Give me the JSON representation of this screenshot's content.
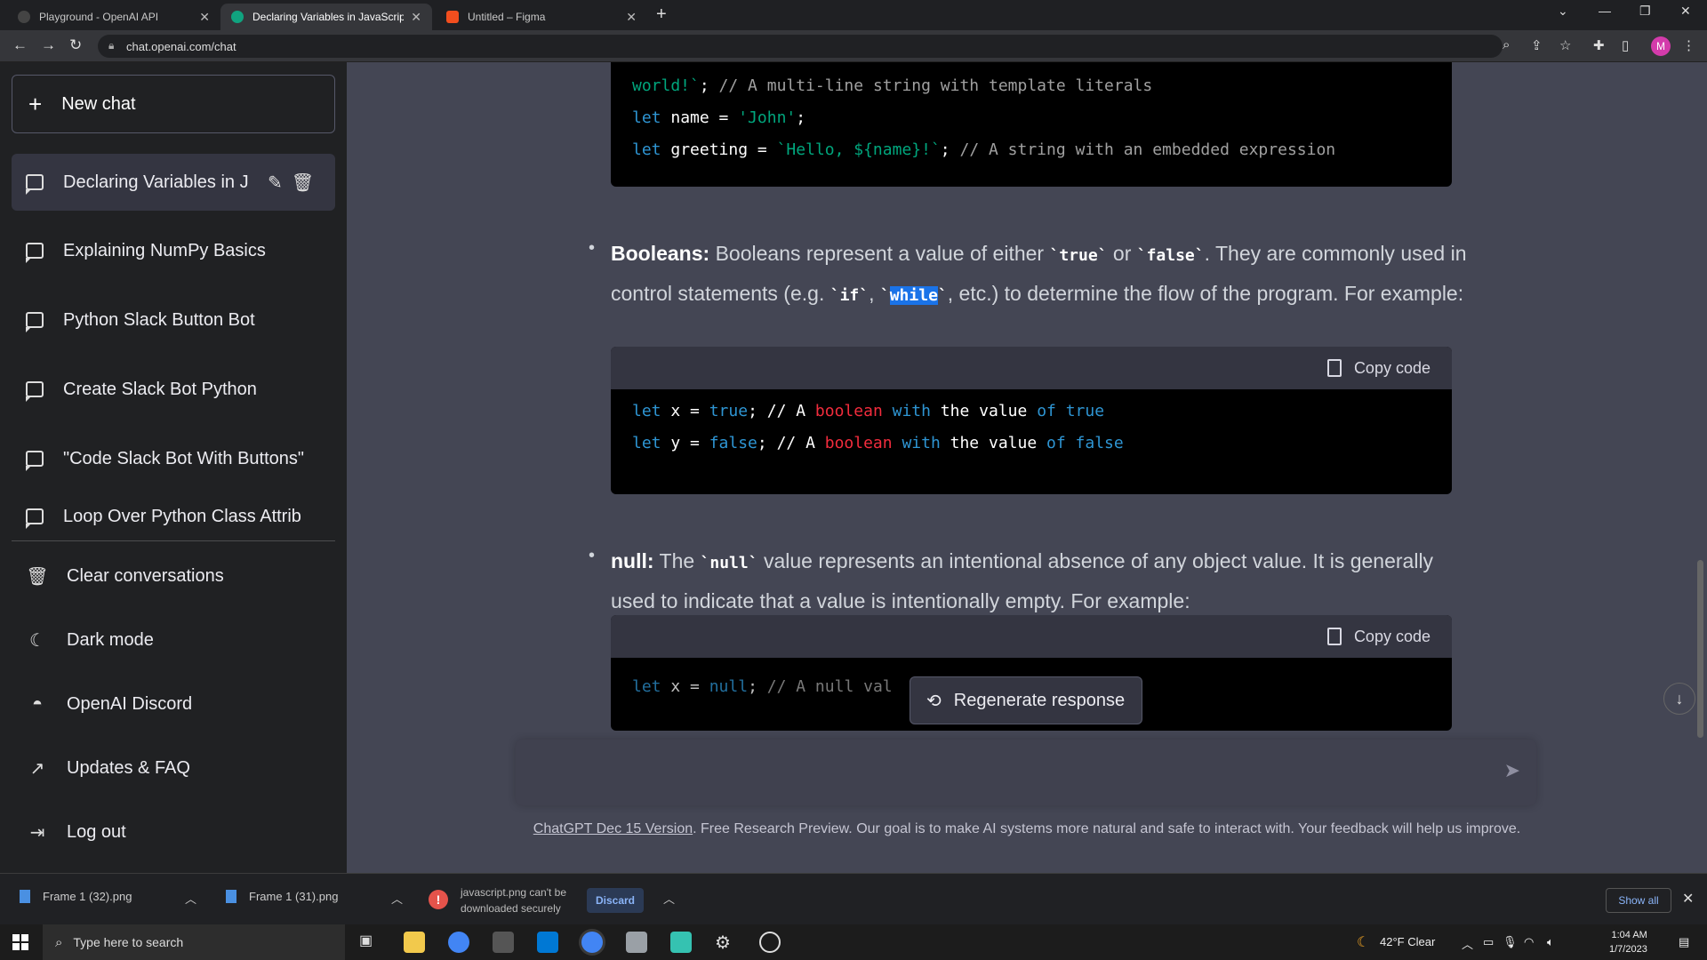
{
  "browser": {
    "tabs": [
      {
        "title": "Playground - OpenAI API",
        "active": false,
        "favicon_color": "#444444"
      },
      {
        "title": "Declaring Variables in JavaScript",
        "active": true,
        "favicon_color": "#10a37f"
      },
      {
        "title": "Untitled – Figma",
        "active": false,
        "favicon_color": "#f24e1e"
      }
    ],
    "url": "chat.openai.com/chat",
    "profile_initial": "M",
    "profile_color": "#d33bab"
  },
  "sidebar": {
    "new_chat": "New chat",
    "conversations": [
      {
        "label": "Declaring Variables in J",
        "active": true
      },
      {
        "label": "Explaining NumPy Basics"
      },
      {
        "label": "Python Slack Button Bot"
      },
      {
        "label": "Create Slack Bot Python"
      },
      {
        "label": "\"Code Slack Bot With Buttons\""
      },
      {
        "label": "Loop Over Python Class Attrib"
      }
    ],
    "menu": [
      {
        "label": "Clear conversations",
        "icon": "trash-icon"
      },
      {
        "label": "Dark mode",
        "icon": "moon-icon"
      },
      {
        "label": "OpenAI Discord",
        "icon": "discord-icon"
      },
      {
        "label": "Updates & FAQ",
        "icon": "external-link-icon"
      },
      {
        "label": "Log out",
        "icon": "logout-icon"
      }
    ]
  },
  "main": {
    "top_code": {
      "line1": {
        "a": "world!`",
        "b": "; ",
        "c": "// A multi-line string with template literals"
      },
      "line2": {
        "a": "let",
        "b": " name = ",
        "c": "'John'",
        "d": ";"
      },
      "line3": {
        "a": "let",
        "b": " greeting = ",
        "c": "`Hello, ${name}!`",
        "d": "; ",
        "e": "// A string with an embedded expression"
      }
    },
    "booleans": {
      "term": "Booleans:",
      "t1": " Booleans represent a value of either ",
      "c1": "`true`",
      "t2": " or ",
      "c2": "`false`",
      "t3": ". They are commonly used in control statements (e.g. ",
      "c3": "`if`",
      "t4": ", ",
      "c4a": "`",
      "c4b": "while",
      "c4c": "`",
      "t5": ", etc.) to determine the flow of the program. For example:"
    },
    "copy_label": "Copy code",
    "bool_code": {
      "line1": {
        "a": "let",
        "b": " x = ",
        "c": "true",
        "d": "; // A ",
        "e": "boolean",
        "f": " with",
        "g": " the value ",
        "h": "of",
        "i": " true"
      },
      "line2": {
        "a": "let",
        "b": " y = ",
        "c": "false",
        "d": "; // A ",
        "e": "boolean",
        "f": " with",
        "g": " the value ",
        "h": "of",
        "i": " false"
      }
    },
    "null": {
      "term": "null:",
      "t1": " The ",
      "c1": "`null`",
      "t2": " value represents an intentional absence of any object value. It is generally used to indicate that a value is intentionally empty. For example:"
    },
    "null_code": {
      "a": "let",
      "b": " x = ",
      "c": "null",
      "d": "; ",
      "e": "// A null val"
    },
    "regenerate": "Regenerate response",
    "footer_link": "ChatGPT Dec 15 Version",
    "footer_text": ". Free Research Preview. Our goal is to make AI systems more natural and safe to interact with. Your feedback will help us improve."
  },
  "downloads": {
    "items": [
      "Frame 1 (32).png",
      "Frame 1 (31).png"
    ],
    "warning": "javascript.png can't be downloaded securely",
    "discard": "Discard",
    "show_all": "Show all"
  },
  "taskbar": {
    "search_placeholder": "Type here to search",
    "weather": "42°F  Clear",
    "time": "1:04 AM",
    "date": "1/7/2023"
  }
}
